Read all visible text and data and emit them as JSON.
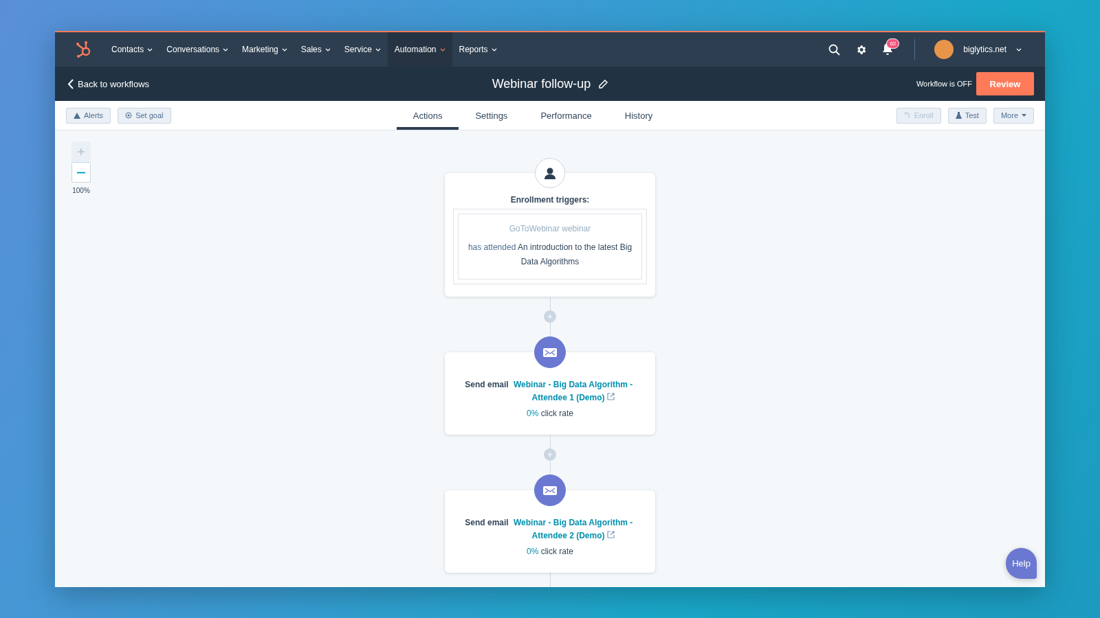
{
  "nav": {
    "items": [
      {
        "label": "Contacts",
        "selected": false
      },
      {
        "label": "Conversations",
        "selected": false
      },
      {
        "label": "Marketing",
        "selected": false
      },
      {
        "label": "Sales",
        "selected": false
      },
      {
        "label": "Service",
        "selected": false
      },
      {
        "label": "Automation",
        "selected": true
      },
      {
        "label": "Reports",
        "selected": false
      }
    ],
    "notification_count": "62",
    "account": "biglytics.net"
  },
  "header": {
    "back": "Back to workflows",
    "title": "Webinar follow-up",
    "status": "Workflow is OFF",
    "review": "Review"
  },
  "toolbar": {
    "left_buttons": [
      {
        "kind": "alerts",
        "label": "Alerts"
      },
      {
        "kind": "goal",
        "label": "Set goal"
      }
    ],
    "tabs": [
      {
        "label": "Actions",
        "selected": true
      },
      {
        "label": "Settings",
        "selected": false
      },
      {
        "label": "Performance",
        "selected": false
      },
      {
        "label": "History",
        "selected": false
      }
    ],
    "right_buttons": [
      {
        "kind": "enroll",
        "label": "Enroll",
        "disabled": true
      },
      {
        "kind": "test",
        "label": "Test",
        "disabled": false
      },
      {
        "kind": "more",
        "label": "More",
        "disabled": false
      }
    ]
  },
  "zoom": {
    "zoom_in_disabled": true,
    "level": "100%"
  },
  "trigger": {
    "heading": "Enrollment triggers:",
    "source": "GoToWebinar webinar",
    "condition": "has attended **An introduction to the latest Big Data Algorithms**"
  },
  "actions": [
    {
      "kind": "email",
      "prefix": "Send email",
      "link": "Webinar - Big Data Algorithm - Attendee 1 (Demo)",
      "rate": "0%",
      "rate_label": "click rate"
    },
    {
      "kind": "email",
      "prefix": "Send email",
      "link": "Webinar - Big Data Algorithm - Attendee 2 (Demo)",
      "rate": "0%",
      "rate_label": "click rate"
    }
  ],
  "help": "Help"
}
